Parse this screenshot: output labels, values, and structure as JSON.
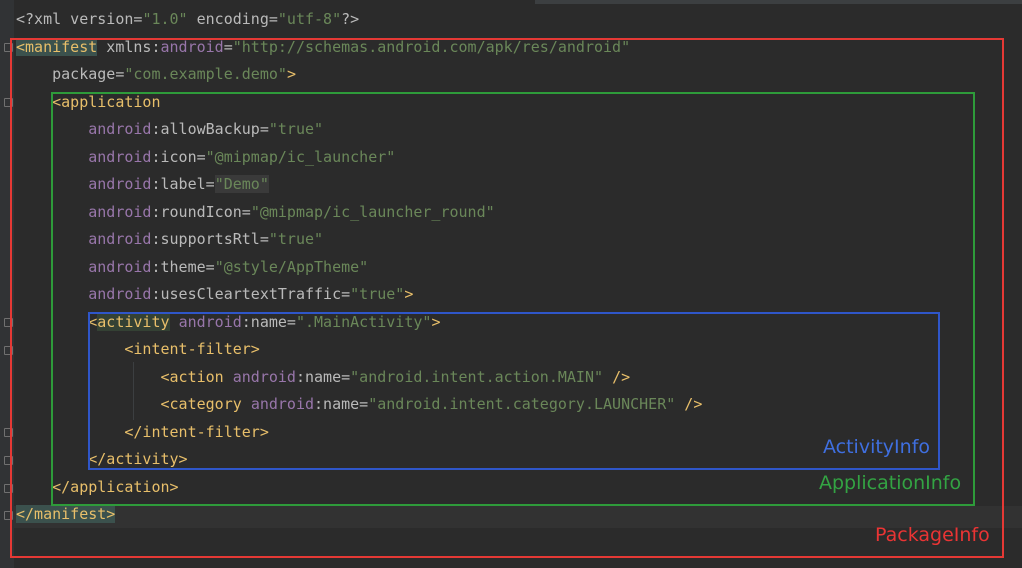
{
  "lines": [
    {
      "indent": "",
      "segs": [
        {
          "k": "a",
          "t": "<?xml version="
        },
        {
          "k": "v",
          "t": "\"1.0\""
        },
        {
          "k": "a",
          "t": " encoding="
        },
        {
          "k": "v",
          "t": "\"utf-8\""
        },
        {
          "k": "a",
          "t": "?>"
        }
      ]
    },
    {
      "indent": "",
      "segs": [
        {
          "k": "t hl-tag",
          "t": "<manifest"
        },
        {
          "k": "a",
          "t": " xmlns:"
        },
        {
          "k": "ns",
          "t": "android"
        },
        {
          "k": "a",
          "t": "="
        },
        {
          "k": "v",
          "t": "\"http://schemas.android.com/apk/res/android\""
        }
      ]
    },
    {
      "indent": "    ",
      "segs": [
        {
          "k": "a",
          "t": "package="
        },
        {
          "k": "v",
          "t": "\"com.example.demo\""
        },
        {
          "k": "t",
          "t": ">"
        }
      ]
    },
    {
      "indent": "    ",
      "segs": [
        {
          "k": "t",
          "t": "<application"
        }
      ]
    },
    {
      "indent": "        ",
      "segs": [
        {
          "k": "ns",
          "t": "android"
        },
        {
          "k": "a",
          "t": ":allowBackup="
        },
        {
          "k": "v",
          "t": "\"true\""
        }
      ]
    },
    {
      "indent": "        ",
      "segs": [
        {
          "k": "ns",
          "t": "android"
        },
        {
          "k": "a",
          "t": ":icon="
        },
        {
          "k": "v",
          "t": "\"@mipmap/ic_launcher\""
        }
      ]
    },
    {
      "indent": "        ",
      "segs": [
        {
          "k": "ns",
          "t": "android"
        },
        {
          "k": "a",
          "t": ":label="
        },
        {
          "k": "v hl-val",
          "t": "\"Demo\""
        }
      ]
    },
    {
      "indent": "        ",
      "segs": [
        {
          "k": "ns",
          "t": "android"
        },
        {
          "k": "a",
          "t": ":roundIcon="
        },
        {
          "k": "v",
          "t": "\"@mipmap/ic_launcher_round\""
        }
      ]
    },
    {
      "indent": "        ",
      "segs": [
        {
          "k": "ns",
          "t": "android"
        },
        {
          "k": "a",
          "t": ":supportsRtl="
        },
        {
          "k": "v",
          "t": "\"true\""
        }
      ]
    },
    {
      "indent": "        ",
      "segs": [
        {
          "k": "ns",
          "t": "android"
        },
        {
          "k": "a",
          "t": ":theme="
        },
        {
          "k": "v",
          "t": "\"@style/AppTheme\""
        }
      ]
    },
    {
      "indent": "        ",
      "segs": [
        {
          "k": "ns",
          "t": "android"
        },
        {
          "k": "a",
          "t": ":usesCleartextTraffic="
        },
        {
          "k": "v",
          "t": "\"true\""
        },
        {
          "k": "t",
          "t": ">"
        }
      ]
    },
    {
      "indent": "        ",
      "segs": [
        {
          "k": "t",
          "t": "<"
        },
        {
          "k": "t hl-word",
          "t": "activity"
        },
        {
          "k": "a",
          "t": " "
        },
        {
          "k": "ns",
          "t": "android"
        },
        {
          "k": "a",
          "t": ":name="
        },
        {
          "k": "v",
          "t": "\".MainActivity\""
        },
        {
          "k": "t",
          "t": ">"
        }
      ]
    },
    {
      "indent": "            ",
      "segs": [
        {
          "k": "t",
          "t": "<intent-filter>"
        }
      ]
    },
    {
      "indent": "                ",
      "segs": [
        {
          "k": "t",
          "t": "<action"
        },
        {
          "k": "a",
          "t": " "
        },
        {
          "k": "ns",
          "t": "android"
        },
        {
          "k": "a",
          "t": ":name="
        },
        {
          "k": "v",
          "t": "\"android.intent.action.MAIN\""
        },
        {
          "k": "a",
          "t": " "
        },
        {
          "k": "t",
          "t": "/>"
        }
      ]
    },
    {
      "indent": "                ",
      "segs": [
        {
          "k": "t",
          "t": "<category"
        },
        {
          "k": "a",
          "t": " "
        },
        {
          "k": "ns",
          "t": "android"
        },
        {
          "k": "a",
          "t": ":name="
        },
        {
          "k": "v",
          "t": "\"android.intent.category.LAUNCHER\""
        },
        {
          "k": "a",
          "t": " "
        },
        {
          "k": "t",
          "t": "/>"
        }
      ]
    },
    {
      "indent": "            ",
      "segs": [
        {
          "k": "t",
          "t": "</intent-filter>"
        }
      ]
    },
    {
      "indent": "        ",
      "segs": [
        {
          "k": "t",
          "t": "</activity>"
        }
      ]
    },
    {
      "indent": "    ",
      "segs": [
        {
          "k": "t",
          "t": "</application>"
        }
      ]
    },
    {
      "indent": "",
      "segs": [
        {
          "k": "t hl-tag",
          "t": "</manifest>"
        }
      ]
    }
  ],
  "annotations": {
    "activity": "ActivityInfo",
    "application": "ApplicationInfo",
    "package": "PackageInfo"
  },
  "colors": {
    "background": "#2b2b2b",
    "tag": "#e8bf6a",
    "value": "#6a8759",
    "namespace": "#9876aa",
    "box_package": "#e53935",
    "box_application": "#2e9b3a",
    "box_activity": "#2f56c9"
  }
}
